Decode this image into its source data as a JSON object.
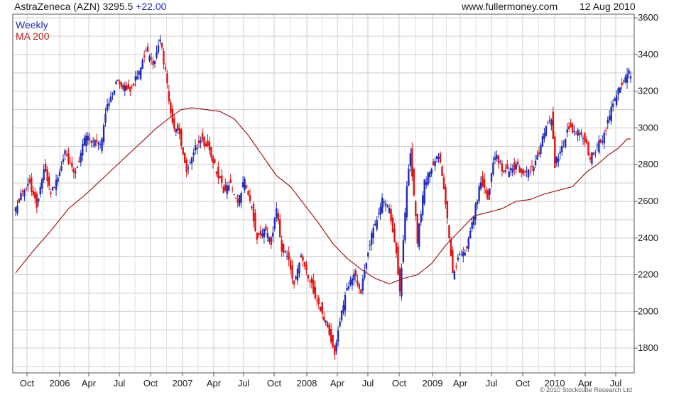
{
  "header": {
    "title": "AstraZeneca (AZN) 3295.5",
    "change": "+22.00",
    "site": "www.fullermoney.com",
    "date": "12 Aug 2010"
  },
  "copyright": "© 2010 Stockcube Research Ltd",
  "chart_data": {
    "type": "candlestick",
    "y_ticks": [
      1800,
      2000,
      2200,
      2400,
      2600,
      2800,
      3000,
      3200,
      3400,
      3600
    ],
    "ylim": [
      1665,
      3620
    ],
    "x_ticks": [
      "Oct",
      "2006",
      "Apr",
      "Jul",
      "Oct",
      "2007",
      "Apr",
      "Jul",
      "Oct",
      "2008",
      "Apr",
      "Jul",
      "Oct",
      "2009",
      "Apr",
      "Jul",
      "Oct",
      "2010",
      "Apr",
      "Jul"
    ],
    "grid": true,
    "up_color": "#1f2bb8",
    "down_color": "#e01010",
    "ma_color": "#a31a1a",
    "series": [
      {
        "name": "Weekly",
        "anchors": [
          [
            0,
            2560
          ],
          [
            3,
            2640
          ],
          [
            8,
            2700
          ],
          [
            12,
            2580
          ],
          [
            16,
            2780
          ],
          [
            20,
            2640
          ],
          [
            24,
            2740
          ],
          [
            28,
            2860
          ],
          [
            34,
            2760
          ],
          [
            40,
            2960
          ],
          [
            48,
            2900
          ],
          [
            52,
            3120
          ],
          [
            58,
            3260
          ],
          [
            64,
            3200
          ],
          [
            70,
            3300
          ],
          [
            74,
            3420
          ],
          [
            78,
            3340
          ],
          [
            82,
            3480
          ],
          [
            85,
            3300
          ],
          [
            89,
            3020
          ],
          [
            93,
            2960
          ],
          [
            97,
            2760
          ],
          [
            101,
            2880
          ],
          [
            105,
            2940
          ],
          [
            110,
            2880
          ],
          [
            114,
            2760
          ],
          [
            118,
            2660
          ],
          [
            122,
            2700
          ],
          [
            126,
            2580
          ],
          [
            130,
            2720
          ],
          [
            134,
            2560
          ],
          [
            137,
            2400
          ],
          [
            141,
            2450
          ],
          [
            145,
            2380
          ],
          [
            148,
            2560
          ],
          [
            151,
            2340
          ],
          [
            155,
            2280
          ],
          [
            158,
            2150
          ],
          [
            162,
            2320
          ],
          [
            166,
            2200
          ],
          [
            170,
            2080
          ],
          [
            174,
            2000
          ],
          [
            178,
            1880
          ],
          [
            181,
            1770
          ],
          [
            184,
            1960
          ],
          [
            188,
            2120
          ],
          [
            192,
            2200
          ],
          [
            196,
            2100
          ],
          [
            200,
            2340
          ],
          [
            204,
            2480
          ],
          [
            208,
            2600
          ],
          [
            212,
            2560
          ],
          [
            216,
            2320
          ],
          [
            218,
            2100
          ],
          [
            222,
            2680
          ],
          [
            224,
            2880
          ],
          [
            228,
            2380
          ],
          [
            232,
            2700
          ],
          [
            236,
            2780
          ],
          [
            240,
            2860
          ],
          [
            244,
            2600
          ],
          [
            248,
            2200
          ],
          [
            252,
            2300
          ],
          [
            256,
            2340
          ],
          [
            260,
            2520
          ],
          [
            264,
            2720
          ],
          [
            268,
            2620
          ],
          [
            272,
            2860
          ],
          [
            276,
            2780
          ],
          [
            280,
            2760
          ],
          [
            284,
            2800
          ],
          [
            288,
            2740
          ],
          [
            292,
            2760
          ],
          [
            296,
            2840
          ],
          [
            300,
            2980
          ],
          [
            304,
            3060
          ],
          [
            306,
            2800
          ],
          [
            310,
            2900
          ],
          [
            314,
            3000
          ],
          [
            318,
            2980
          ],
          [
            322,
            2960
          ],
          [
            326,
            2840
          ],
          [
            330,
            2900
          ],
          [
            334,
            2960
          ],
          [
            338,
            3100
          ],
          [
            341,
            3180
          ],
          [
            344,
            3240
          ],
          [
            347,
            3300
          ]
        ]
      },
      {
        "name": "MA 200",
        "anchors": [
          [
            0,
            2210
          ],
          [
            10,
            2330
          ],
          [
            20,
            2440
          ],
          [
            30,
            2560
          ],
          [
            40,
            2640
          ],
          [
            50,
            2730
          ],
          [
            60,
            2820
          ],
          [
            70,
            2910
          ],
          [
            80,
            3000
          ],
          [
            88,
            3060
          ],
          [
            94,
            3100
          ],
          [
            100,
            3110
          ],
          [
            108,
            3100
          ],
          [
            116,
            3090
          ],
          [
            124,
            3050
          ],
          [
            132,
            2960
          ],
          [
            140,
            2850
          ],
          [
            148,
            2740
          ],
          [
            156,
            2680
          ],
          [
            164,
            2580
          ],
          [
            172,
            2480
          ],
          [
            180,
            2370
          ],
          [
            188,
            2290
          ],
          [
            196,
            2230
          ],
          [
            204,
            2180
          ],
          [
            212,
            2150
          ],
          [
            220,
            2180
          ],
          [
            228,
            2200
          ],
          [
            236,
            2260
          ],
          [
            244,
            2360
          ],
          [
            252,
            2440
          ],
          [
            260,
            2520
          ],
          [
            268,
            2540
          ],
          [
            276,
            2560
          ],
          [
            284,
            2600
          ],
          [
            292,
            2610
          ],
          [
            300,
            2640
          ],
          [
            308,
            2660
          ],
          [
            316,
            2680
          ],
          [
            324,
            2760
          ],
          [
            330,
            2800
          ],
          [
            336,
            2850
          ],
          [
            342,
            2890
          ],
          [
            347,
            2940
          ]
        ]
      }
    ]
  }
}
